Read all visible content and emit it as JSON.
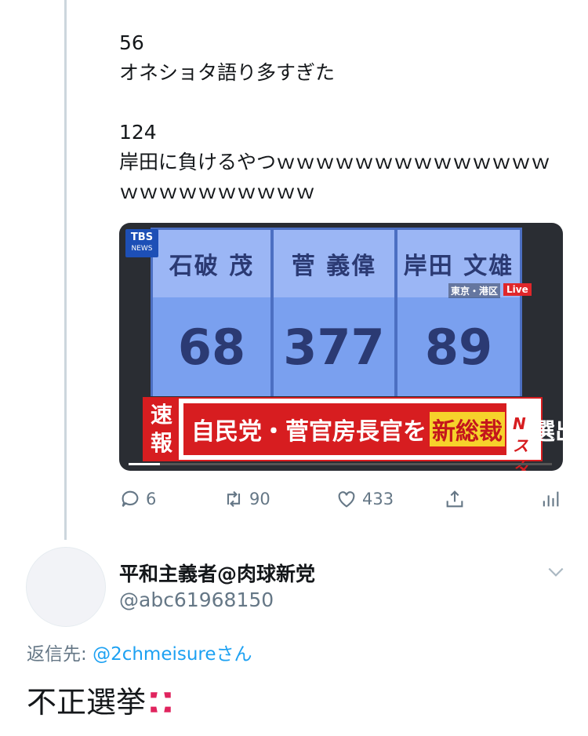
{
  "tweet1": {
    "number_a": "56",
    "text_a": "オネショタ語り多すぎた",
    "number_b": "124",
    "text_b_line1": "岸田に負けるやつｗｗｗｗｗｗｗｗｗｗｗｗｗｗ",
    "text_b_line2": "ｗｗｗｗｗｗｗｗｗｗ",
    "media": {
      "logo_line1": "TBS",
      "logo_line2": "NEWS",
      "candidates": [
        {
          "name": "石破 茂",
          "votes": "68"
        },
        {
          "name": "菅 義偉",
          "votes": "377"
        },
        {
          "name": "岸田 文雄",
          "votes": "89"
        }
      ],
      "location": "東京・港区",
      "live": "Live",
      "breaking": "速報",
      "banner_pre": "自民党・菅官房長官を",
      "banner_hl": "新総裁",
      "banner_post": "に選出",
      "corner_logo": "Nスタ"
    },
    "actions": {
      "reply_count": "6",
      "retweet_count": "90",
      "like_count": "433"
    }
  },
  "tweet2": {
    "display_name": "平和主義者@肉球新党",
    "handle": "@abc61968150",
    "reply_label": "返信先: ",
    "reply_mention": "@2chmeisure",
    "reply_suffix": "さん",
    "text": "不正選挙"
  },
  "colors": {
    "accent": "#1da1f2",
    "secondary_text": "#657786",
    "thread_line": "#ccd6dd"
  }
}
